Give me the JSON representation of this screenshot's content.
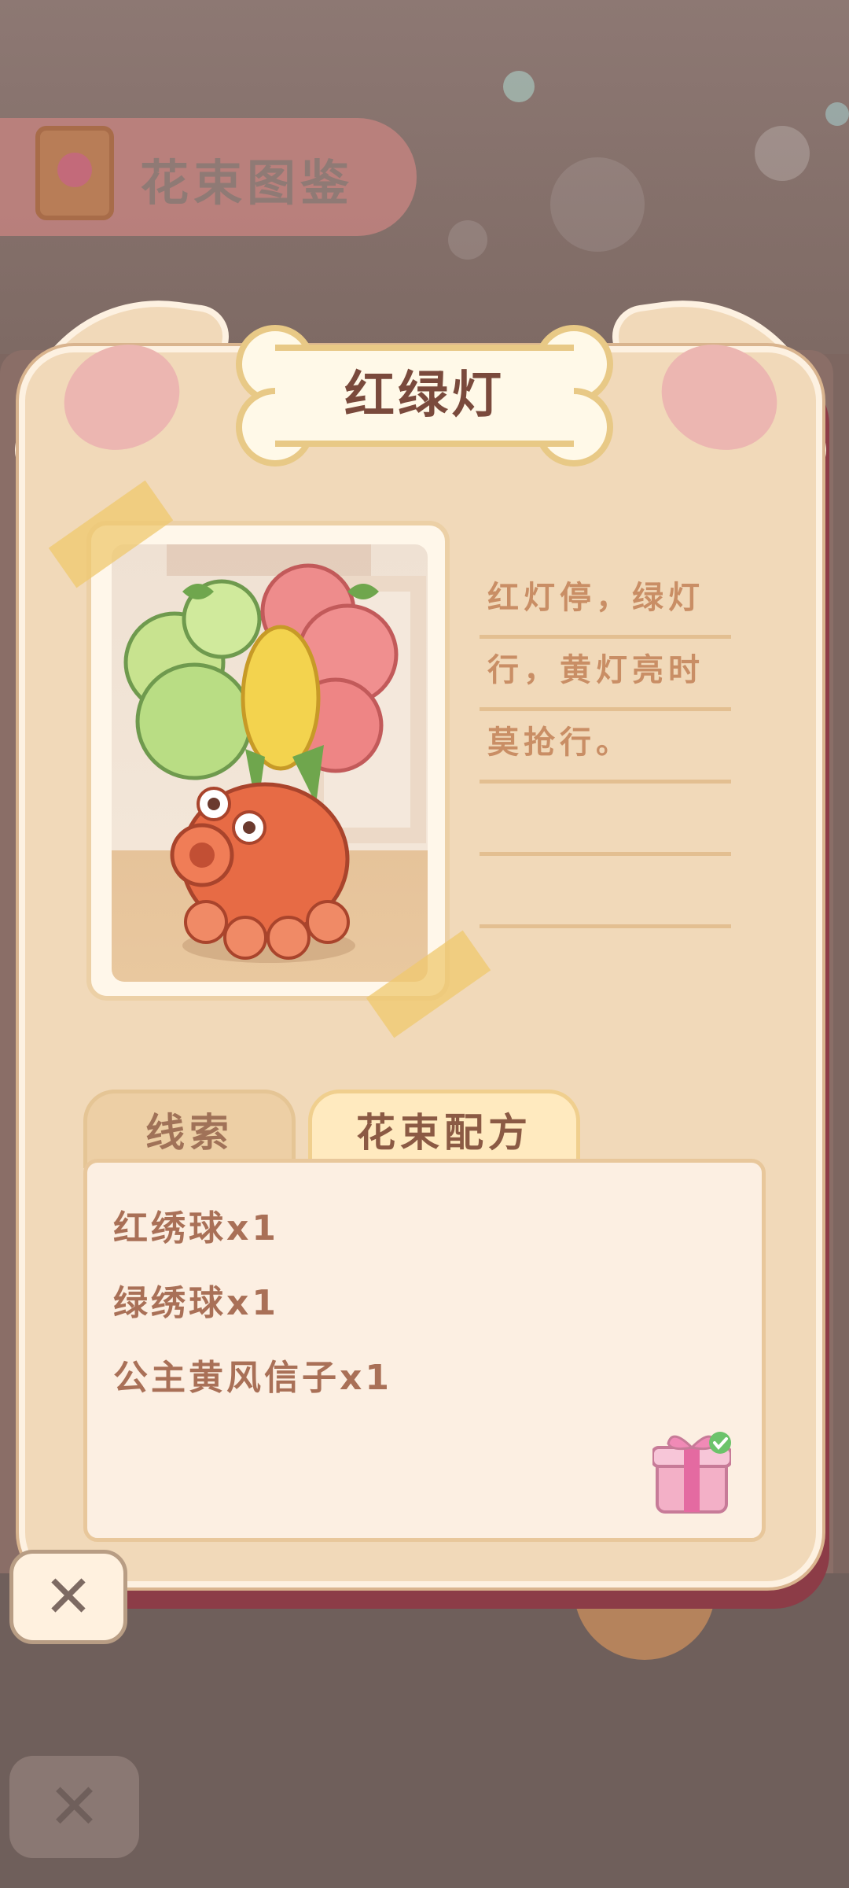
{
  "header": {
    "title": "花束图鉴",
    "icon": "album-book-icon"
  },
  "card": {
    "name": "红绿灯",
    "image": "bouquet-vase-illustration",
    "description_lines": [
      "红灯停，绿灯",
      "行，黄灯亮时",
      "莫抢行。",
      "",
      ""
    ]
  },
  "tabs": [
    {
      "label": "线索",
      "selected": false
    },
    {
      "label": "花束配方",
      "selected": true
    }
  ],
  "recipe": {
    "items": [
      "红绣球x1",
      "绿绣球x1",
      "公主黄风信子x1"
    ],
    "reward_icon": "gift-box-claimed-icon"
  },
  "buttons": {
    "close_label": "✕"
  },
  "colors": {
    "accent": "#8c3c47",
    "card": "#f1d9b9",
    "text": "#a97057"
  }
}
